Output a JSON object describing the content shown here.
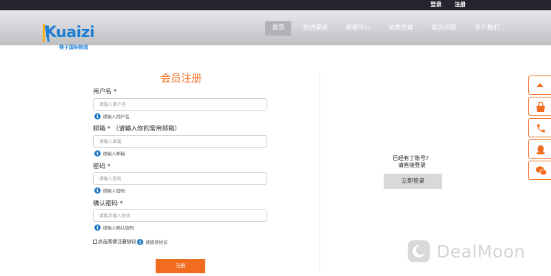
{
  "topbar": {
    "login": "登录",
    "register": "注册"
  },
  "logo": {
    "word": "Kuaizi",
    "subtitle": "筷子国际物流"
  },
  "nav": [
    {
      "label": "首页",
      "active": true
    },
    {
      "label": "物流渠道"
    },
    {
      "label": "新闻中心"
    },
    {
      "label": "运费估算"
    },
    {
      "label": "常见问题"
    },
    {
      "label": "关于我们"
    }
  ],
  "form": {
    "title": "会员注册",
    "username": {
      "label": "用户名 *",
      "placeholder": "请输入用户名",
      "hint": "请输入用户名"
    },
    "email": {
      "label": "邮箱 * （请输入你的常用邮箱）",
      "placeholder": "请输入邮箱",
      "hint": "请输入邮箱"
    },
    "password": {
      "label": "密码 *",
      "placeholder": "请输入密码",
      "hint": "请输入密码"
    },
    "confirm": {
      "label": "确认密码 *",
      "placeholder": "请再次输入密码",
      "hint": "请输入确认密码"
    },
    "agreement": {
      "label": "点击阅读注册协议",
      "hint": "请阅读协议"
    },
    "submit": "注册"
  },
  "aside": {
    "line1": "已经有了账号？",
    "line2": "请直接登录",
    "login_button": "立即登录"
  },
  "side_buttons": [
    "up-arrow-icon",
    "shopping-bag-icon",
    "phone-icon",
    "qq-icon",
    "wechat-icon"
  ],
  "watermark": {
    "text": "DealMoon"
  },
  "colors": {
    "accent": "#f26c1f",
    "logo_blue": "#1e7fd6",
    "topbar": "#23242e",
    "info_blue": "#1e78c8"
  }
}
